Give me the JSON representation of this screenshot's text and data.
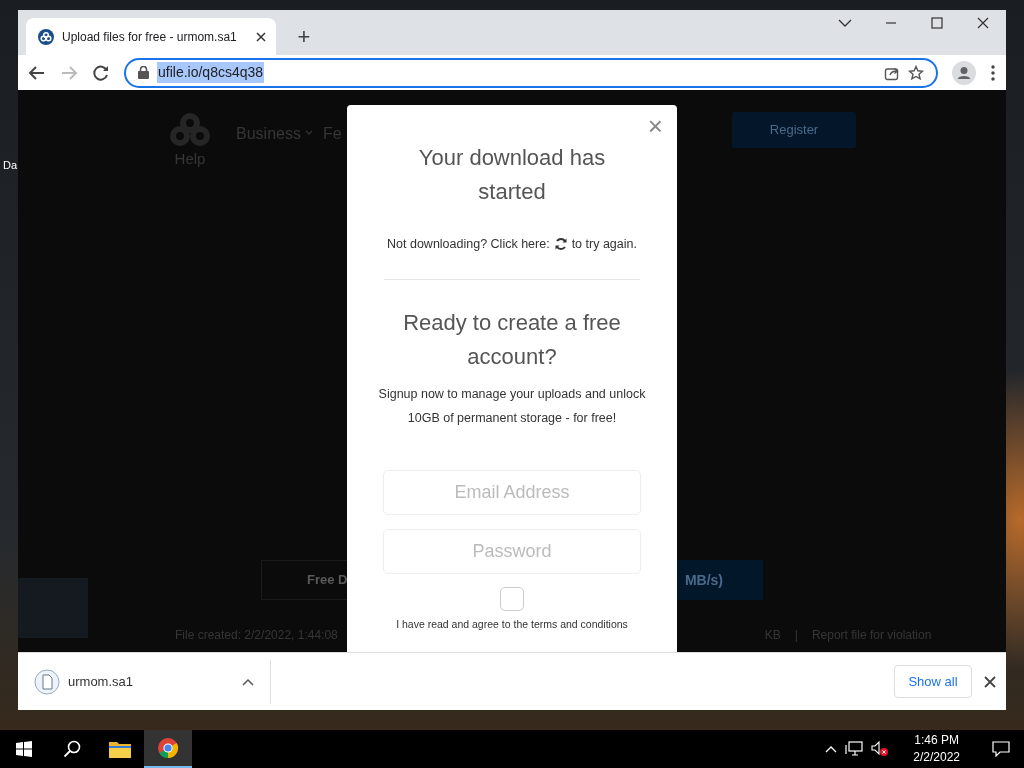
{
  "browser": {
    "tab": {
      "title": "Upload files for free - urmom.sa1",
      "selected": true
    },
    "new_tab": "+",
    "address": "ufile.io/q8cs4q38"
  },
  "page": {
    "nav": [
      "Business",
      "Fe"
    ],
    "help": "Help",
    "register": "Register",
    "download_button": "Free D",
    "speed_button": "MB/s)",
    "footer": [
      "File created: 2/2/2022, 1:44:08",
      "KB",
      "|",
      "Report file for violation"
    ]
  },
  "modal": {
    "close": "×",
    "title": "Your download has started",
    "retry_before": "Not downloading? Click here:",
    "retry_after": "to try again.",
    "signup_title": "Ready to create a free account?",
    "signup_text": "Signup now to manage your uploads and unlock 10GB of permanent storage - for free!",
    "email_placeholder": "Email Address",
    "password_placeholder": "Password",
    "terms": {
      "label": "I have read and agree to the terms and conditions",
      "checked": false
    }
  },
  "downloads": {
    "file": "urmom.sa1",
    "show_all": "Show all"
  },
  "desktop": {
    "icon_label": "Da"
  },
  "taskbar": {
    "time": "1:46 PM",
    "date": "2/2/2022"
  }
}
